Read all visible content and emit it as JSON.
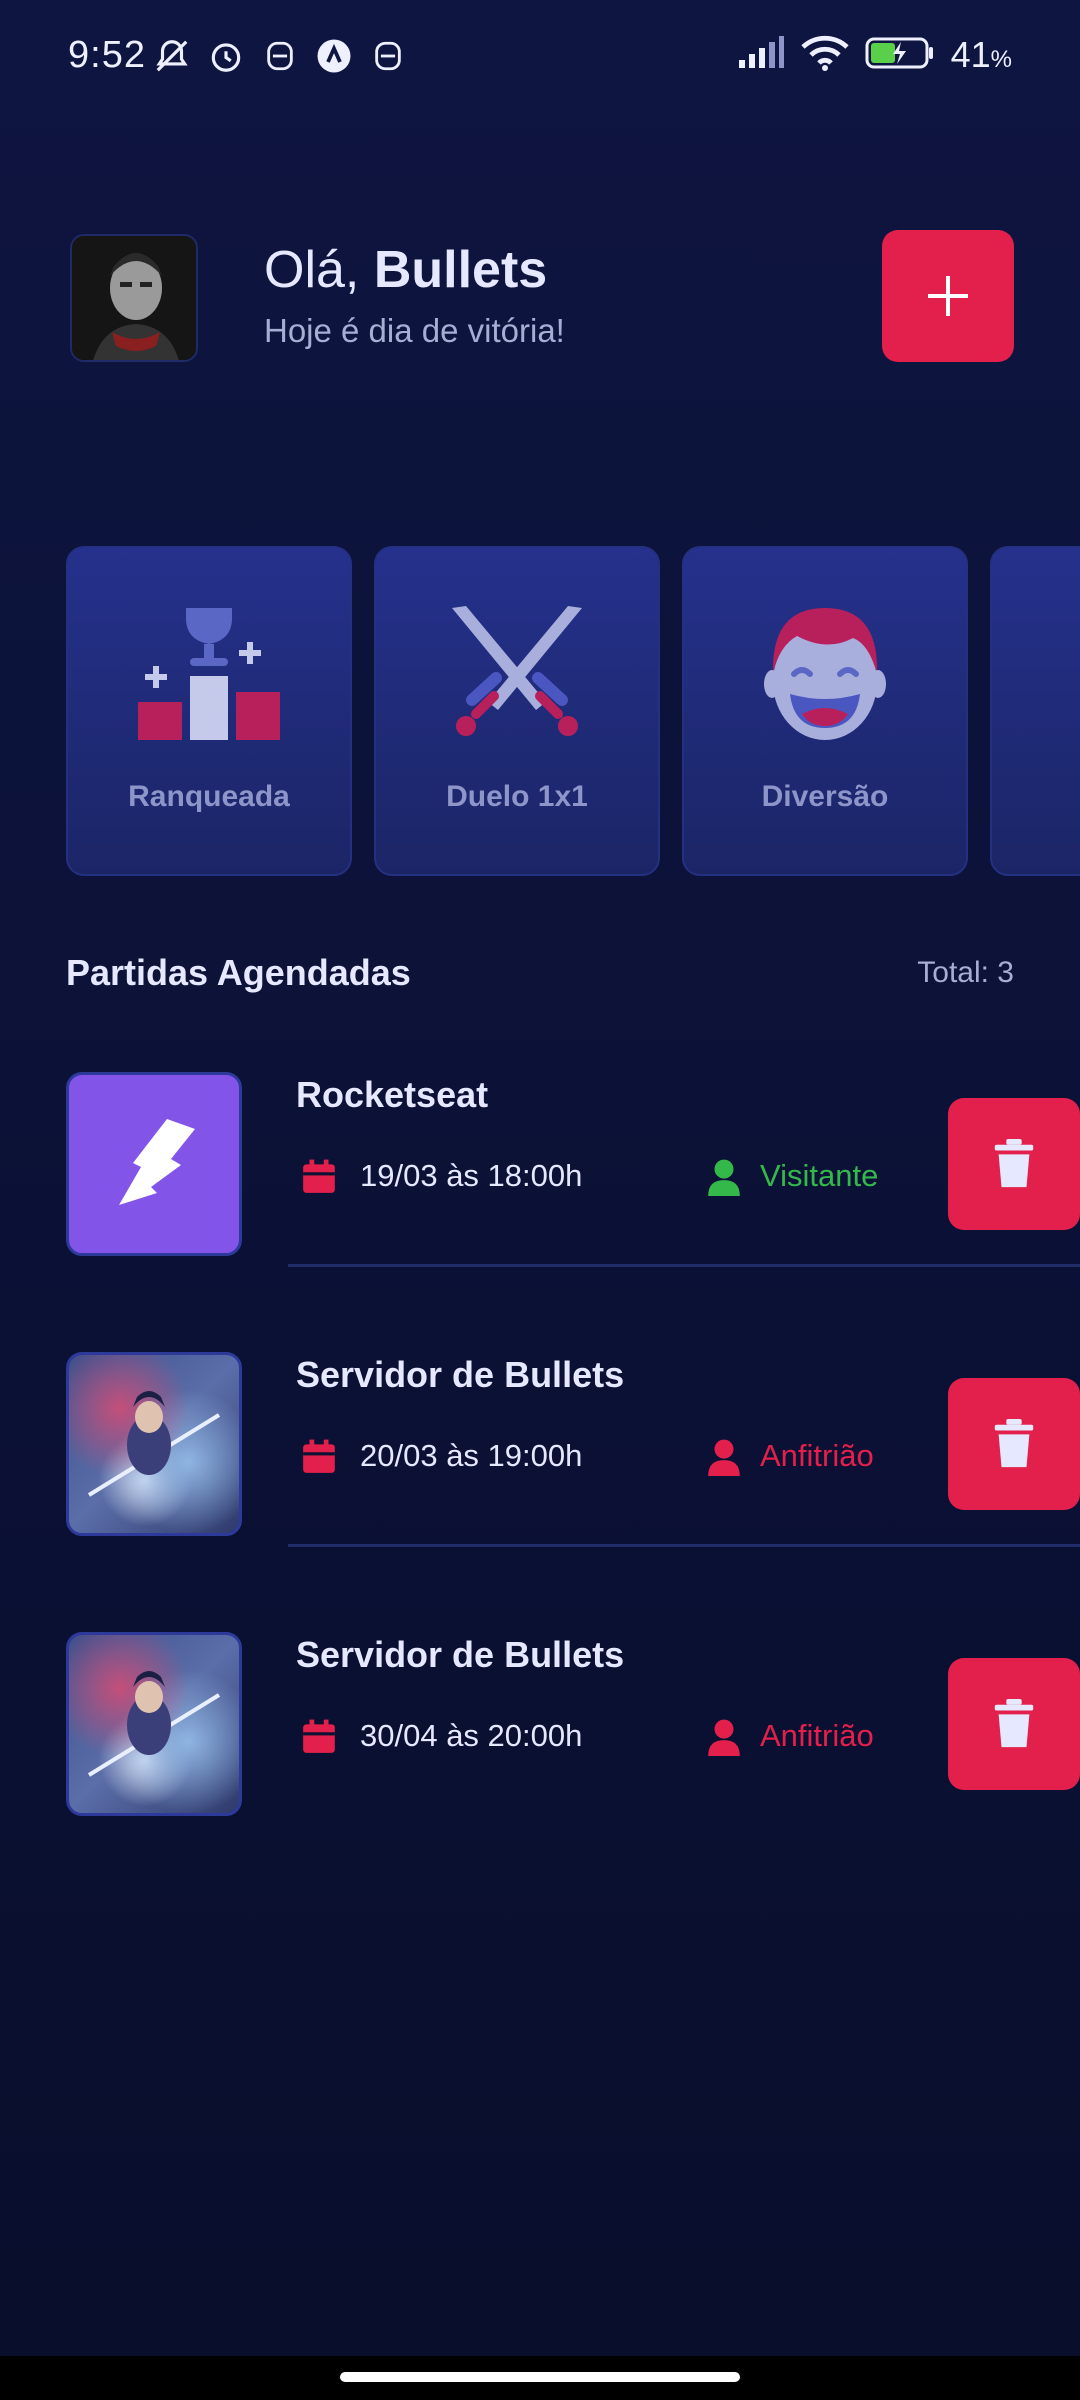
{
  "status_bar": {
    "time": "9:52",
    "battery": "41",
    "battery_unit": "%"
  },
  "header": {
    "greeting_prefix": "Olá, ",
    "user_name": "Bullets",
    "subtitle": "Hoje é dia de vitória!",
    "add_button_icon": "plus-icon"
  },
  "categories": [
    {
      "label": "Ranqueada",
      "icon": "ranked-podium-icon"
    },
    {
      "label": "Duelo 1x1",
      "icon": "crossed-swords-icon"
    },
    {
      "label": "Diversão",
      "icon": "laughing-face-icon"
    },
    {
      "label": "",
      "icon": "partial-card-icon"
    }
  ],
  "matches_section": {
    "title": "Partidas Agendadas",
    "total": "Total: 3"
  },
  "matches": [
    {
      "name": "Rocketseat",
      "date": "19/03 às 18:00h",
      "role": "Visitante",
      "role_color": "#34b84a",
      "thumb": "rocketseat-logo"
    },
    {
      "name": "Servidor de Bullets",
      "date": "20/03 às 19:00h",
      "role": "Anfitrião",
      "role_color": "#e3204b",
      "thumb": "server-art"
    },
    {
      "name": "Servidor de Bullets",
      "date": "30/04 às 20:00h",
      "role": "Anfitrião",
      "role_color": "#e3204b",
      "thumb": "server-art"
    }
  ],
  "colors": {
    "accent": "#e3204b",
    "background": "#0c1233",
    "card": "#25318c",
    "visitor": "#34b84a"
  }
}
